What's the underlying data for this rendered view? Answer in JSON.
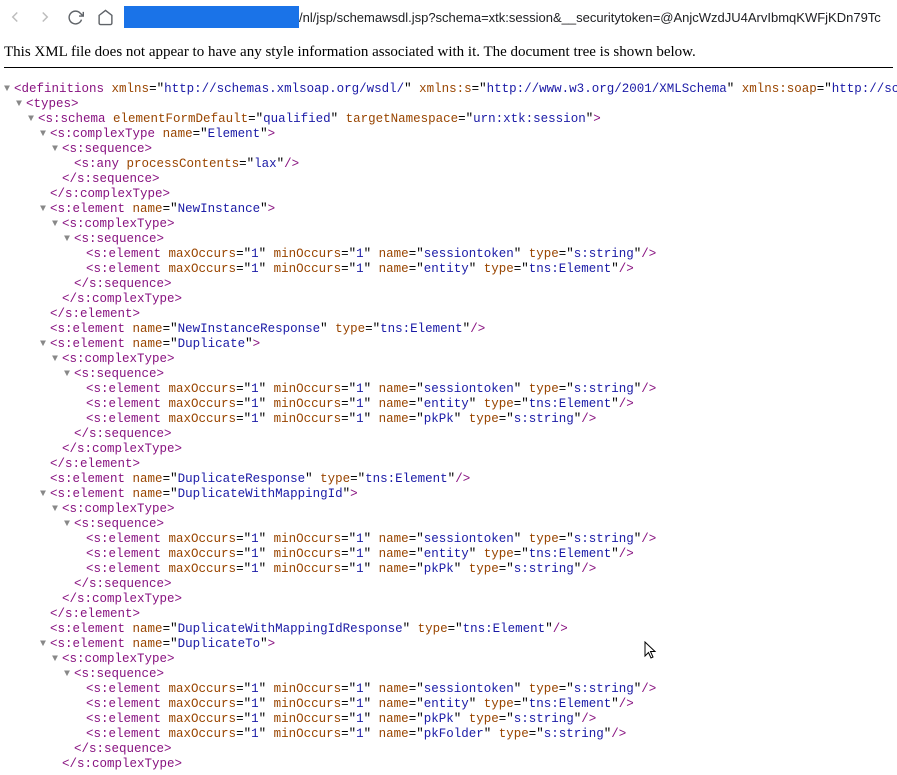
{
  "nav": {
    "url_path": "/nl/jsp/schemawsdl.jsp?schema=xtk:session&__securitytoken=@AnjcWzdJU4ArvIbmqKWFjKDn79Tc"
  },
  "notice": "This XML file does not appear to have any style information associated with it. The document tree is shown below.",
  "xml": {
    "definitions": {
      "tag": "definitions",
      "attrs": {
        "xmlns": "http://schemas.xmlsoap.org/wsdl/",
        "xmlns:s": "http://www.w3.org/2001/XMLSchema",
        "xmlns:soap": "http://schemas."
      }
    },
    "types": {
      "tag": "types"
    },
    "schema": {
      "tag": "s:schema",
      "attrs": {
        "elementFormDefault": "qualified",
        "targetNamespace": "urn:xtk:session"
      }
    },
    "elementComplexType": {
      "tag": "s:complexType",
      "attrs": {
        "name": "Element"
      }
    },
    "sequence": {
      "tag": "s:sequence"
    },
    "any": {
      "tag": "s:any",
      "attrs": {
        "processContents": "lax"
      }
    },
    "complexType": {
      "tag": "s:complexType"
    },
    "elementClose": {
      "tag": "/s:element"
    },
    "complexTypeClose": {
      "tag": "/s:complexType"
    },
    "sequenceClose": {
      "tag": "/s:sequence"
    },
    "newInstance": {
      "tag": "s:element",
      "attrs": {
        "name": "NewInstance"
      }
    },
    "elSessionToken": {
      "tag": "s:element",
      "attrs": {
        "maxOccurs": "1",
        "minOccurs": "1",
        "name": "sessiontoken",
        "type": "s:string"
      }
    },
    "elEntity": {
      "tag": "s:element",
      "attrs": {
        "maxOccurs": "1",
        "minOccurs": "1",
        "name": "entity",
        "type": "tns:Element"
      }
    },
    "elPkPk": {
      "tag": "s:element",
      "attrs": {
        "maxOccurs": "1",
        "minOccurs": "1",
        "name": "pkPk",
        "type": "s:string"
      }
    },
    "elPkFolder": {
      "tag": "s:element",
      "attrs": {
        "maxOccurs": "1",
        "minOccurs": "1",
        "name": "pkFolder",
        "type": "s:string"
      }
    },
    "newInstanceResp": {
      "tag": "s:element",
      "attrs": {
        "name": "NewInstanceResponse",
        "type": "tns:Element"
      }
    },
    "duplicate": {
      "tag": "s:element",
      "attrs": {
        "name": "Duplicate"
      }
    },
    "duplicateResp": {
      "tag": "s:element",
      "attrs": {
        "name": "DuplicateResponse",
        "type": "tns:Element"
      }
    },
    "dupWithMap": {
      "tag": "s:element",
      "attrs": {
        "name": "DuplicateWithMappingId"
      }
    },
    "dupWithMapResp": {
      "tag": "s:element",
      "attrs": {
        "name": "DuplicateWithMappingIdResponse",
        "type": "tns:Element"
      }
    },
    "duplicateTo": {
      "tag": "s:element",
      "attrs": {
        "name": "DuplicateTo"
      }
    }
  }
}
